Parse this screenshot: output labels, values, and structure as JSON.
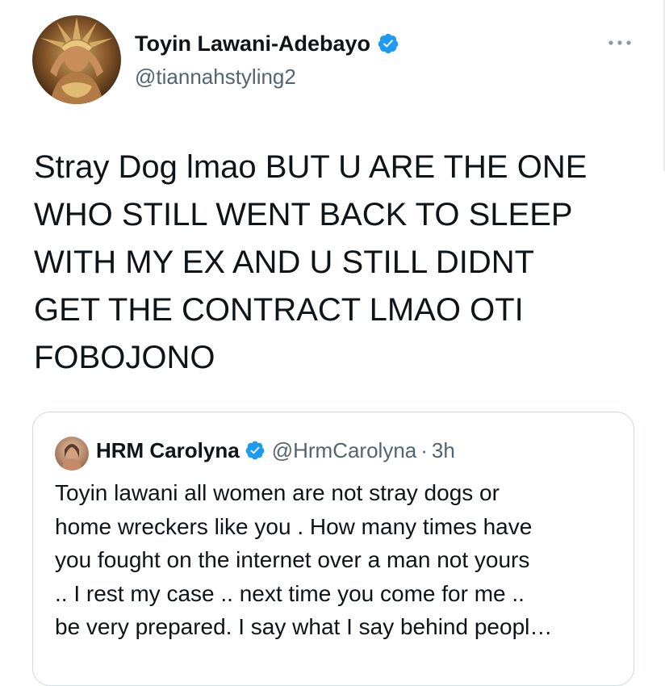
{
  "tweet": {
    "author": {
      "display_name": "Toyin Lawani-Adebayo",
      "handle": "@tiannahstyling2",
      "verified": true,
      "avatar": "profile-photo"
    },
    "more_menu_icon": "more-horizontal-icon",
    "text": "Stray Dog lmao BUT U ARE THE ONE\nWHO STILL WENT BACK TO SLEEP\nWITH MY EX AND U STILL DIDNT\nGET THE CONTRACT LMAO OTI\nFOBOJONO"
  },
  "quoted_tweet": {
    "author": {
      "display_name": "HRM Carolyna",
      "handle": "@HrmCarolyna",
      "verified": true,
      "avatar": "profile-photo"
    },
    "separator": "·",
    "time": "3h",
    "text": "Toyin lawani all women are not stray dogs or\nhome wreckers like you . How many times have\nyou fought on the internet over a man not yours\n.. I rest my case .. next time you come for me ..\nbe very prepared. I say what I say behind peopl…"
  },
  "colors": {
    "text_primary": "#0f1419",
    "text_secondary": "#536471",
    "verified_blue": "#1d9bf0",
    "border": "#cfd9de"
  }
}
